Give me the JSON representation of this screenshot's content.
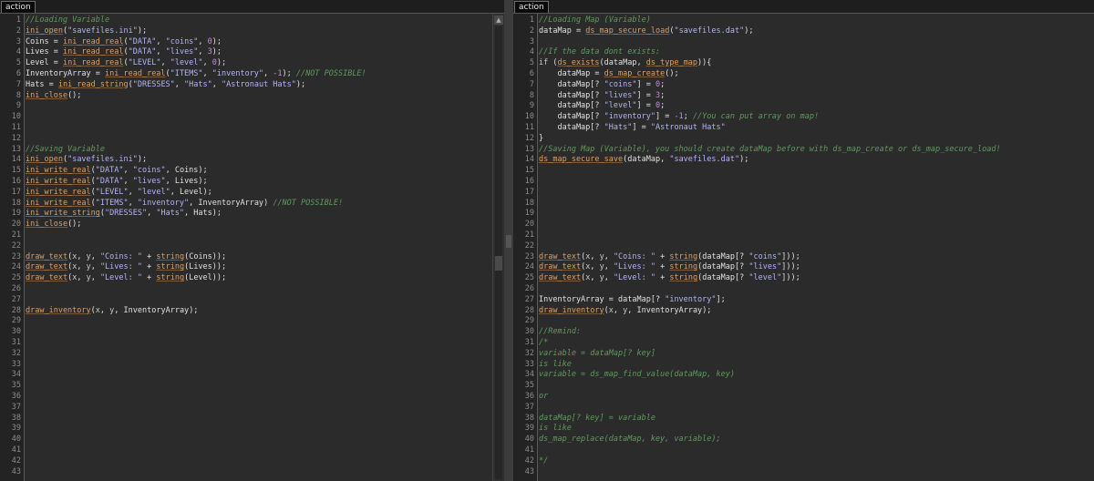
{
  "left_pane": {
    "tab_label": "action",
    "lines": [
      [
        [
          "c-com",
          "//Loading Variable"
        ]
      ],
      [
        [
          "c-fn",
          "ini_open"
        ],
        [
          "c-op",
          "("
        ],
        [
          "c-str",
          "\"savefiles.ini\""
        ],
        [
          "c-op",
          ");"
        ]
      ],
      [
        [
          "c-var",
          "Coins "
        ],
        [
          "c-op",
          "= "
        ],
        [
          "c-fn",
          "ini_read_real"
        ],
        [
          "c-op",
          "("
        ],
        [
          "c-str",
          "\"DATA\""
        ],
        [
          "c-op",
          ", "
        ],
        [
          "c-str",
          "\"coins\""
        ],
        [
          "c-op",
          ", "
        ],
        [
          "c-num",
          "0"
        ],
        [
          "c-op",
          ");"
        ]
      ],
      [
        [
          "c-var",
          "Lives "
        ],
        [
          "c-op",
          "= "
        ],
        [
          "c-fn",
          "ini_read_real"
        ],
        [
          "c-op",
          "("
        ],
        [
          "c-str",
          "\"DATA\""
        ],
        [
          "c-op",
          ", "
        ],
        [
          "c-str",
          "\"lives\""
        ],
        [
          "c-op",
          ", "
        ],
        [
          "c-num",
          "3"
        ],
        [
          "c-op",
          ");"
        ]
      ],
      [
        [
          "c-var",
          "Level "
        ],
        [
          "c-op",
          "= "
        ],
        [
          "c-fn",
          "ini_read_real"
        ],
        [
          "c-op",
          "("
        ],
        [
          "c-str",
          "\"LEVEL\""
        ],
        [
          "c-op",
          ", "
        ],
        [
          "c-str",
          "\"level\""
        ],
        [
          "c-op",
          ", "
        ],
        [
          "c-num",
          "0"
        ],
        [
          "c-op",
          ");"
        ]
      ],
      [
        [
          "c-var",
          "InventoryArray "
        ],
        [
          "c-op",
          "= "
        ],
        [
          "c-fn",
          "ini_read_real"
        ],
        [
          "c-op",
          "("
        ],
        [
          "c-str",
          "\"ITEMS\""
        ],
        [
          "c-op",
          ", "
        ],
        [
          "c-str",
          "\"inventory\""
        ],
        [
          "c-op",
          ", "
        ],
        [
          "c-num",
          "-1"
        ],
        [
          "c-op",
          "); "
        ],
        [
          "c-com",
          "//NOT POSSIBLE!"
        ]
      ],
      [
        [
          "c-var",
          "Hats "
        ],
        [
          "c-op",
          "= "
        ],
        [
          "c-fn",
          "ini_read_string"
        ],
        [
          "c-op",
          "("
        ],
        [
          "c-str",
          "\"DRESSES\""
        ],
        [
          "c-op",
          ", "
        ],
        [
          "c-str",
          "\"Hats\""
        ],
        [
          "c-op",
          ", "
        ],
        [
          "c-str",
          "\"Astronaut Hats\""
        ],
        [
          "c-op",
          ");"
        ]
      ],
      [
        [
          "c-fn",
          "ini_close"
        ],
        [
          "c-op",
          "();"
        ]
      ],
      [],
      [],
      [],
      [],
      [
        [
          "c-com",
          "//Saving Variable"
        ]
      ],
      [
        [
          "c-fn",
          "ini_open"
        ],
        [
          "c-op",
          "("
        ],
        [
          "c-str",
          "\"savefiles.ini\""
        ],
        [
          "c-op",
          ");"
        ]
      ],
      [
        [
          "c-fn",
          "ini_write_real"
        ],
        [
          "c-op",
          "("
        ],
        [
          "c-str",
          "\"DATA\""
        ],
        [
          "c-op",
          ", "
        ],
        [
          "c-str",
          "\"coins\""
        ],
        [
          "c-op",
          ", "
        ],
        [
          "c-var",
          "Coins"
        ],
        [
          "c-op",
          ");"
        ]
      ],
      [
        [
          "c-fn",
          "ini_write_real"
        ],
        [
          "c-op",
          "("
        ],
        [
          "c-str",
          "\"DATA\""
        ],
        [
          "c-op",
          ", "
        ],
        [
          "c-str",
          "\"lives\""
        ],
        [
          "c-op",
          ", "
        ],
        [
          "c-var",
          "Lives"
        ],
        [
          "c-op",
          ");"
        ]
      ],
      [
        [
          "c-fn",
          "ini_write_real"
        ],
        [
          "c-op",
          "("
        ],
        [
          "c-str",
          "\"LEVEL\""
        ],
        [
          "c-op",
          ", "
        ],
        [
          "c-str",
          "\"level\""
        ],
        [
          "c-op",
          ", "
        ],
        [
          "c-var",
          "Level"
        ],
        [
          "c-op",
          ");"
        ]
      ],
      [
        [
          "c-fn",
          "ini_write_real"
        ],
        [
          "c-op",
          "("
        ],
        [
          "c-str",
          "\"ITEMS\""
        ],
        [
          "c-op",
          ", "
        ],
        [
          "c-str",
          "\"inventory\""
        ],
        [
          "c-op",
          ", "
        ],
        [
          "c-var",
          "InventoryArray"
        ],
        [
          "c-op",
          ") "
        ],
        [
          "c-com",
          "//NOT POSSIBLE!"
        ]
      ],
      [
        [
          "c-fn",
          "ini_write_string"
        ],
        [
          "c-op",
          "("
        ],
        [
          "c-str",
          "\"DRESSES\""
        ],
        [
          "c-op",
          ", "
        ],
        [
          "c-str",
          "\"Hats\""
        ],
        [
          "c-op",
          ", "
        ],
        [
          "c-var",
          "Hats"
        ],
        [
          "c-op",
          ");"
        ]
      ],
      [
        [
          "c-fn",
          "ini_close"
        ],
        [
          "c-op",
          "();"
        ]
      ],
      [],
      [],
      [
        [
          "c-fn",
          "draw_text"
        ],
        [
          "c-op",
          "("
        ],
        [
          "c-kw",
          "x"
        ],
        [
          "c-op",
          ", "
        ],
        [
          "c-kw",
          "y"
        ],
        [
          "c-op",
          ", "
        ],
        [
          "c-str",
          "\"Coins: \""
        ],
        [
          "c-op",
          " + "
        ],
        [
          "c-fn",
          "string"
        ],
        [
          "c-op",
          "("
        ],
        [
          "c-var",
          "Coins"
        ],
        [
          "c-op",
          "));"
        ]
      ],
      [
        [
          "c-fn",
          "draw_text"
        ],
        [
          "c-op",
          "("
        ],
        [
          "c-kw",
          "x"
        ],
        [
          "c-op",
          ", "
        ],
        [
          "c-kw",
          "y"
        ],
        [
          "c-op",
          ", "
        ],
        [
          "c-str",
          "\"Lives: \""
        ],
        [
          "c-op",
          " + "
        ],
        [
          "c-fn",
          "string"
        ],
        [
          "c-op",
          "("
        ],
        [
          "c-var",
          "Lives"
        ],
        [
          "c-op",
          "));"
        ]
      ],
      [
        [
          "c-fn",
          "draw_text"
        ],
        [
          "c-op",
          "("
        ],
        [
          "c-kw",
          "x"
        ],
        [
          "c-op",
          ", "
        ],
        [
          "c-kw",
          "y"
        ],
        [
          "c-op",
          ", "
        ],
        [
          "c-str",
          "\"Level: \""
        ],
        [
          "c-op",
          " + "
        ],
        [
          "c-fn",
          "string"
        ],
        [
          "c-op",
          "("
        ],
        [
          "c-var",
          "Level"
        ],
        [
          "c-op",
          "));"
        ]
      ],
      [],
      [],
      [
        [
          "c-fn",
          "draw_inventory"
        ],
        [
          "c-op",
          "("
        ],
        [
          "c-kw",
          "x"
        ],
        [
          "c-op",
          ", "
        ],
        [
          "c-kw",
          "y"
        ],
        [
          "c-op",
          ", "
        ],
        [
          "c-var",
          "InventoryArray"
        ],
        [
          "c-op",
          ");"
        ]
      ],
      [],
      [],
      [],
      [],
      [],
      [],
      [],
      [],
      [],
      [],
      [],
      [],
      [],
      [],
      []
    ]
  },
  "right_pane": {
    "tab_label": "action",
    "lines": [
      [
        [
          "c-com",
          "//Loading Map (Variable)"
        ]
      ],
      [
        [
          "c-var",
          "dataMap "
        ],
        [
          "c-op",
          "= "
        ],
        [
          "c-fn",
          "ds_map_secure_load"
        ],
        [
          "c-op",
          "("
        ],
        [
          "c-str",
          "\"savefiles.dat\""
        ],
        [
          "c-op",
          ");"
        ]
      ],
      [],
      [
        [
          "c-com",
          "//If the data dont exists:"
        ]
      ],
      [
        [
          "c-kw",
          "if "
        ],
        [
          "c-op",
          "("
        ],
        [
          "c-fn",
          "ds_exists"
        ],
        [
          "c-op",
          "("
        ],
        [
          "c-var",
          "dataMap"
        ],
        [
          "c-op",
          ", "
        ],
        [
          "c-fn",
          "ds_type_map"
        ],
        [
          "c-op",
          ")){"
        ]
      ],
      [
        [
          "c-var",
          "    dataMap "
        ],
        [
          "c-op",
          "= "
        ],
        [
          "c-fn",
          "ds_map_create"
        ],
        [
          "c-op",
          "();"
        ]
      ],
      [
        [
          "c-var",
          "    dataMap"
        ],
        [
          "c-op",
          "[? "
        ],
        [
          "c-str",
          "\"coins\""
        ],
        [
          "c-op",
          "] = "
        ],
        [
          "c-num",
          "0"
        ],
        [
          "c-op",
          ";"
        ]
      ],
      [
        [
          "c-var",
          "    dataMap"
        ],
        [
          "c-op",
          "[? "
        ],
        [
          "c-str",
          "\"lives\""
        ],
        [
          "c-op",
          "] = "
        ],
        [
          "c-num",
          "3"
        ],
        [
          "c-op",
          ";"
        ]
      ],
      [
        [
          "c-var",
          "    dataMap"
        ],
        [
          "c-op",
          "[? "
        ],
        [
          "c-str",
          "\"level\""
        ],
        [
          "c-op",
          "] = "
        ],
        [
          "c-num",
          "0"
        ],
        [
          "c-op",
          ";"
        ]
      ],
      [
        [
          "c-var",
          "    dataMap"
        ],
        [
          "c-op",
          "[? "
        ],
        [
          "c-str",
          "\"inventory\""
        ],
        [
          "c-op",
          "] = "
        ],
        [
          "c-num",
          "-1"
        ],
        [
          "c-op",
          "; "
        ],
        [
          "c-com",
          "//You can put array on map!"
        ]
      ],
      [
        [
          "c-var",
          "    dataMap"
        ],
        [
          "c-op",
          "[? "
        ],
        [
          "c-str",
          "\"Hats\""
        ],
        [
          "c-op",
          "] = "
        ],
        [
          "c-str",
          "\"Astronaut Hats\""
        ]
      ],
      [
        [
          "c-op",
          "}"
        ]
      ],
      [
        [
          "c-com",
          "//Saving Map (Variable), you should create dataMap before with ds_map_create or ds_map_secure_load!"
        ]
      ],
      [
        [
          "c-fn",
          "ds_map_secure_save"
        ],
        [
          "c-op",
          "("
        ],
        [
          "c-var",
          "dataMap"
        ],
        [
          "c-op",
          ", "
        ],
        [
          "c-str",
          "\"savefiles.dat\""
        ],
        [
          "c-op",
          ");"
        ]
      ],
      [],
      [],
      [],
      [],
      [],
      [],
      [],
      [],
      [
        [
          "c-fn",
          "draw_text"
        ],
        [
          "c-op",
          "("
        ],
        [
          "c-kw",
          "x"
        ],
        [
          "c-op",
          ", "
        ],
        [
          "c-kw",
          "y"
        ],
        [
          "c-op",
          ", "
        ],
        [
          "c-str",
          "\"Coins: \""
        ],
        [
          "c-op",
          " + "
        ],
        [
          "c-fn",
          "string"
        ],
        [
          "c-op",
          "("
        ],
        [
          "c-var",
          "dataMap"
        ],
        [
          "c-op",
          "[? "
        ],
        [
          "c-str",
          "\"coins\""
        ],
        [
          "c-op",
          "]));"
        ]
      ],
      [
        [
          "c-fn",
          "draw_text"
        ],
        [
          "c-op",
          "("
        ],
        [
          "c-kw",
          "x"
        ],
        [
          "c-op",
          ", "
        ],
        [
          "c-kw",
          "y"
        ],
        [
          "c-op",
          ", "
        ],
        [
          "c-str",
          "\"Lives: \""
        ],
        [
          "c-op",
          " + "
        ],
        [
          "c-fn",
          "string"
        ],
        [
          "c-op",
          "("
        ],
        [
          "c-var",
          "dataMap"
        ],
        [
          "c-op",
          "[? "
        ],
        [
          "c-str",
          "\"lives\""
        ],
        [
          "c-op",
          "]));"
        ]
      ],
      [
        [
          "c-fn",
          "draw_text"
        ],
        [
          "c-op",
          "("
        ],
        [
          "c-kw",
          "x"
        ],
        [
          "c-op",
          ", "
        ],
        [
          "c-kw",
          "y"
        ],
        [
          "c-op",
          ", "
        ],
        [
          "c-str",
          "\"Level: \""
        ],
        [
          "c-op",
          " + "
        ],
        [
          "c-fn",
          "string"
        ],
        [
          "c-op",
          "("
        ],
        [
          "c-var",
          "dataMap"
        ],
        [
          "c-op",
          "[? "
        ],
        [
          "c-str",
          "\"level\""
        ],
        [
          "c-op",
          "]));"
        ]
      ],
      [],
      [
        [
          "c-var",
          "InventoryArray "
        ],
        [
          "c-op",
          "= "
        ],
        [
          "c-var",
          "dataMap"
        ],
        [
          "c-op",
          "[? "
        ],
        [
          "c-str",
          "\"inventory\""
        ],
        [
          "c-op",
          "];"
        ]
      ],
      [
        [
          "c-fn",
          "draw_inventory"
        ],
        [
          "c-op",
          "("
        ],
        [
          "c-kw",
          "x"
        ],
        [
          "c-op",
          ", "
        ],
        [
          "c-kw",
          "y"
        ],
        [
          "c-op",
          ", "
        ],
        [
          "c-var",
          "InventoryArray"
        ],
        [
          "c-op",
          ");"
        ]
      ],
      [],
      [
        [
          "c-com",
          "//Remind:"
        ]
      ],
      [
        [
          "c-com",
          "/*"
        ]
      ],
      [
        [
          "c-com",
          "variable = dataMap[? key]"
        ]
      ],
      [
        [
          "c-com",
          "is like"
        ]
      ],
      [
        [
          "c-com",
          "variable = ds_map_find_value(dataMap, key)"
        ]
      ],
      [],
      [
        [
          "c-com",
          "or"
        ]
      ],
      [],
      [
        [
          "c-com",
          "dataMap[? key] = variable"
        ]
      ],
      [
        [
          "c-com",
          "is like"
        ]
      ],
      [
        [
          "c-com",
          "ds_map_replace(dataMap, key, variable);"
        ]
      ],
      [],
      [
        [
          "c-com",
          "*/"
        ]
      ],
      []
    ]
  },
  "scrollbar": {
    "up_arrow_icon": "arrow-up-icon"
  },
  "colors": {
    "background": "#2b2b2b",
    "gutter": "#232323",
    "comment": "#5f9a5f",
    "function": "#d9a06a",
    "string": "#b3b3f5",
    "number": "#c08de0",
    "text": "#e0e0e0"
  }
}
